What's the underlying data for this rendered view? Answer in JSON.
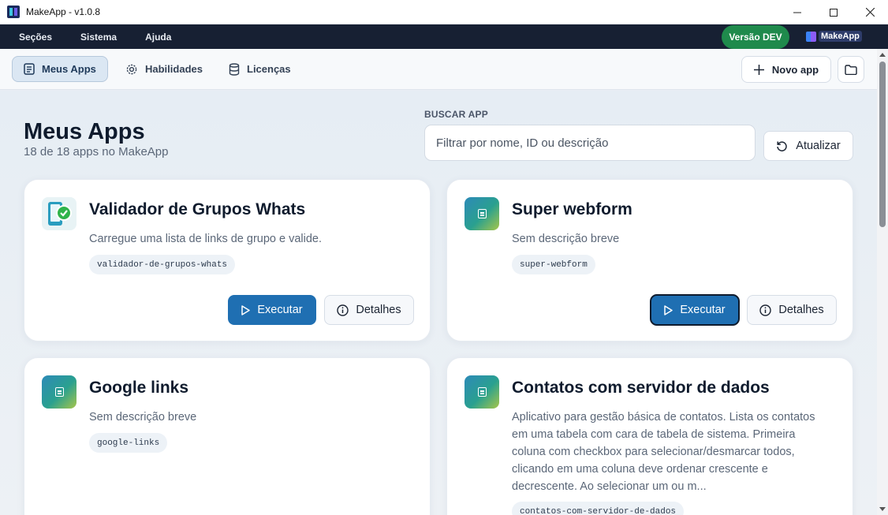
{
  "window": {
    "title": "MakeApp - v1.0.8",
    "minimize": "—",
    "maximize": "☐",
    "close": "✕"
  },
  "menu": {
    "items": [
      "Seções",
      "Sistema",
      "Ajuda"
    ],
    "dev_badge": "Versão DEV",
    "brand": "MakeApp"
  },
  "tabs": {
    "items": [
      {
        "label": "Meus Apps",
        "icon": "list-icon",
        "active": true
      },
      {
        "label": "Habilidades",
        "icon": "gear-icon",
        "active": false
      },
      {
        "label": "Licenças",
        "icon": "database-icon",
        "active": false
      }
    ],
    "new_app": "Novo app",
    "folder_icon": "folder-icon"
  },
  "header": {
    "title": "Meus Apps",
    "subtitle": "18 de 18 apps no MakeApp"
  },
  "search": {
    "label": "BUSCAR APP",
    "placeholder": "Filtrar por nome, ID ou descrição",
    "value": "",
    "refresh": "Atualizar"
  },
  "apps": [
    {
      "name": "Validador de Grupos Whats",
      "description": "Carregue uma lista de links de grupo e valide.",
      "slug": "validador-de-grupos-whats",
      "icon": "phone-check-icon",
      "run": "Executar",
      "details": "Detalhes"
    },
    {
      "name": "Super webform",
      "description": "Sem descrição breve",
      "slug": "super-webform",
      "icon": "document-icon",
      "run": "Executar",
      "details": "Detalhes"
    },
    {
      "name": "Google links",
      "description": "Sem descrição breve",
      "slug": "google-links",
      "icon": "document-icon"
    },
    {
      "name": "Contatos com servidor de dados",
      "description": "Aplicativo para gestão básica de contatos. Lista os contatos em uma tabela com cara de tabela de sistema. Primeira coluna com checkbox para selecionar/desmarcar todos, clicando em uma coluna deve ordenar crescente e decrescente. Ao selecionar um ou m...",
      "slug": "contatos-com-servidor-de-dados",
      "icon": "document-icon"
    }
  ],
  "colors": {
    "menubar": "#172033",
    "accent": "#1f6fb2",
    "dev_badge": "#1f8a4c"
  }
}
